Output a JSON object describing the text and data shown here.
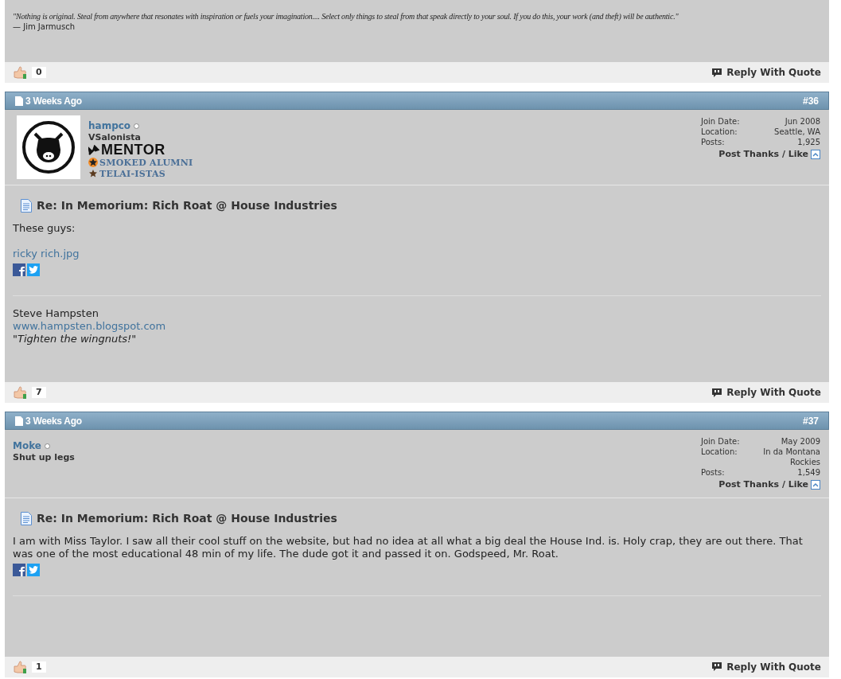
{
  "top_post": {
    "signature": {
      "quote": "\"Nothing is original. Steal from anywhere that resonates with inspiration or fuels your imagination.... Select only things to steal from that speak directly to your soul. If you do this, your work (and theft) will be authentic.\"",
      "attribution": "— Jim Jarmusch"
    },
    "likes": "0",
    "reply_button": "Reply With Quote"
  },
  "posts": [
    {
      "date": "3 Weeks Ago",
      "number": "#36",
      "user": {
        "name": "hampco",
        "online": false,
        "has_avatar": true,
        "title": "VSalonista",
        "ranks": [
          {
            "kind": "mentor",
            "label": "MENTOR"
          },
          {
            "kind": "orange-star",
            "label": "SMOKED ALUMNI"
          },
          {
            "kind": "brown-star",
            "label": "TELAI-ISTAS"
          }
        ]
      },
      "stats": [
        {
          "label": "Join Date:",
          "value": "Jun 2008"
        },
        {
          "label": "Location:",
          "value": "Seattle, WA"
        },
        {
          "label": "Posts:",
          "value": "1,925"
        }
      ],
      "thanks_link": "Post Thanks / Like",
      "post_title": "Re: In Memorium: Rich Roat @ House Industries",
      "body": [
        {
          "kind": "text",
          "text": "These guys:"
        },
        {
          "kind": "link",
          "text": "ricky rich.jpg"
        },
        {
          "kind": "share"
        }
      ],
      "signature": [
        {
          "kind": "text",
          "text": "Steve Hampsten"
        },
        {
          "kind": "link",
          "text": "www.hampsten.blogspot.com"
        },
        {
          "kind": "italic",
          "text": "\"Tighten the wingnuts!\""
        }
      ],
      "likes": "7",
      "reply_button": "Reply With Quote"
    },
    {
      "date": "3 Weeks Ago",
      "number": "#37",
      "user": {
        "name": "Moke",
        "online": false,
        "has_avatar": false,
        "title": "Shut up legs"
      },
      "stats": [
        {
          "label": "Join Date:",
          "value": "May 2009"
        },
        {
          "label": "Location:",
          "value": "In da Montana Rockies"
        },
        {
          "label": "Posts:",
          "value": "1,549"
        }
      ],
      "thanks_link": "Post Thanks / Like",
      "post_title": "Re: In Memorium: Rich Roat @ House Industries",
      "body": [
        {
          "kind": "text",
          "text": "I am with Miss Taylor. I saw all their cool stuff on the website, but had no idea at all what a big deal the House Ind. is. Holy crap, they are out there. That was one of the most educational 48 min of my life. The dude got it and passed it on. Godspeed, Mr. Roat."
        },
        {
          "kind": "share"
        }
      ],
      "likes": "1",
      "reply_button": "Reply With Quote"
    }
  ]
}
